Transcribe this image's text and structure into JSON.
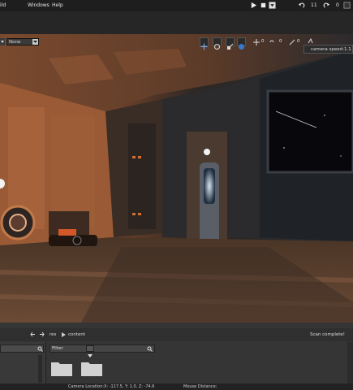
{
  "menu": {
    "item_build": "ild",
    "item_windows": "Windows",
    "item_help": "Help"
  },
  "toolbar": {
    "undo_count": "11",
    "redo_count": "0"
  },
  "viewport": {
    "dropdown_left_value": "None",
    "camera_speed": "camera speed:1.1",
    "tool_counts": {
      "count_a": "0",
      "count_b": "0",
      "count_c": "0"
    }
  },
  "assets": {
    "breadcrumb": [
      "res",
      "content"
    ],
    "scan_status": "Scan complete!",
    "filter_label": "Filter",
    "folders": [
      {
        "name": "folder-1"
      },
      {
        "name": "folder-2"
      }
    ]
  },
  "status_bar": {
    "camera_location": "Camera Location:X: -117.5, Y: 1.0, Z: -74.6",
    "mouse_distance": "Mouse Distance:"
  },
  "colors": {
    "accent": "#e2e2e2",
    "panel": "#353535",
    "dark": "#1e1e1e"
  }
}
